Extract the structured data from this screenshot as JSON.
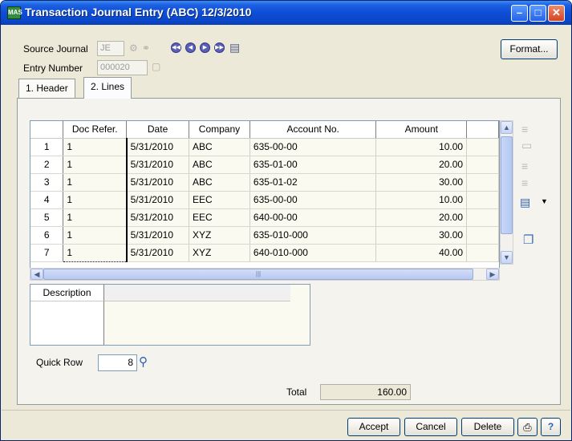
{
  "window": {
    "title": "Transaction Journal Entry (ABC) 12/3/2010",
    "app_icon": "MAS"
  },
  "header": {
    "source_journal_label": "Source Journal",
    "source_journal_value": "JE",
    "entry_number_label": "Entry Number",
    "entry_number_value": "000020",
    "format_button": "Format..."
  },
  "tabs": [
    {
      "label": "1. Header",
      "active": false
    },
    {
      "label": "2. Lines",
      "active": true
    }
  ],
  "lines": {
    "columns": [
      "",
      "Doc Refer.",
      "Date",
      "Company",
      "Account No.",
      "Amount"
    ],
    "rows": [
      {
        "n": "1",
        "doc": "1",
        "date": "5/31/2010",
        "company": "ABC",
        "account": "635-00-00",
        "amount": "10.00"
      },
      {
        "n": "2",
        "doc": "1",
        "date": "5/31/2010",
        "company": "ABC",
        "account": "635-01-00",
        "amount": "20.00"
      },
      {
        "n": "3",
        "doc": "1",
        "date": "5/31/2010",
        "company": "ABC",
        "account": "635-01-02",
        "amount": "30.00"
      },
      {
        "n": "4",
        "doc": "1",
        "date": "5/31/2010",
        "company": "EEC",
        "account": "635-00-00",
        "amount": "10.00"
      },
      {
        "n": "5",
        "doc": "1",
        "date": "5/31/2010",
        "company": "EEC",
        "account": "640-00-00",
        "amount": "20.00"
      },
      {
        "n": "6",
        "doc": "1",
        "date": "5/31/2010",
        "company": "XYZ",
        "account": "635-010-000",
        "amount": "30.00"
      },
      {
        "n": "7",
        "doc": "1",
        "date": "5/31/2010",
        "company": "XYZ",
        "account": "640-010-000",
        "amount": "40.00"
      }
    ]
  },
  "description": {
    "header": "Description"
  },
  "quick_row": {
    "label": "Quick Row",
    "value": "8"
  },
  "total": {
    "label": "Total",
    "value": "160.00"
  },
  "footer": {
    "accept": "Accept",
    "cancel": "Cancel",
    "delete": "Delete"
  }
}
